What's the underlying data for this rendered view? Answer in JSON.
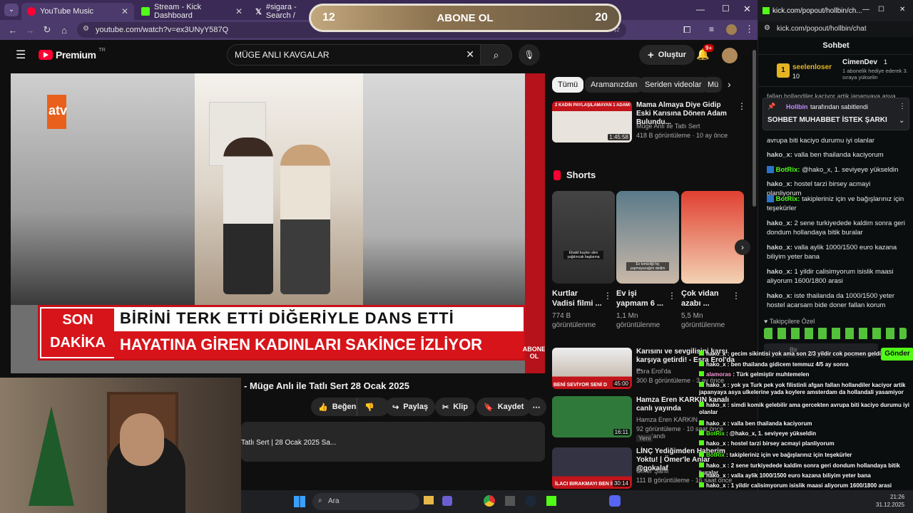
{
  "tabs": [
    {
      "label": "YouTube Music",
      "color": "#ff0033"
    },
    {
      "label": "Stream - Kick Dashboard",
      "color": "#53fc18"
    },
    {
      "label": "#sigara - Search /",
      "color": "#000000"
    }
  ],
  "browser": {
    "url": "youtube.com/watch?v=ex3UNyY587Q"
  },
  "youtube": {
    "logo": "Premium",
    "logo_region": "TR",
    "search_value": "MÜGE ANLI KAVGALAR",
    "create_label": "Oluştur",
    "notif_count": "9+",
    "video_title": "- Müge Anlı ile Tatlı Sert 28 Ocak 2025",
    "channel_logo": "atv",
    "description_snippet": "Tatlı Sert | 28 Ocak 2025 Sa...",
    "chyron_badge_top": "SON",
    "chyron_badge_bottom": "DAKİKA",
    "chyron_line1": "BİRİNİ TERK ETTİ DİĞERİYLE DANS ETTİ",
    "chyron_line2": "HAYATINA GİREN KADINLARI SAKİNCE İZLİYOR",
    "corner_watermark": "ABONE OL",
    "actions": {
      "like": "Beğen",
      "share": "Paylaş",
      "clip": "Klip",
      "save": "Kaydet"
    },
    "chips": [
      "Tümü",
      "Aramanızdan",
      "Seriden videolar",
      "Mü"
    ],
    "recs": [
      {
        "title": "Mama Almaya Diye Gidip Eski Karısına Dönen Adam Bulundu...",
        "channel": "Müge Anlı ile Tatlı Sert",
        "meta": "418 B görüntüleme · 10 ay önce",
        "duration": "1:45:58",
        "thumb_caption": "2 KADIN PAYLAŞILAMAYAN 1 ADAM!"
      },
      {
        "title": "Karısını ve sevgilisini karşı karşıya getirdi! - Esra Erol'da ...",
        "channel": "Esra Erol'da",
        "meta": "300 B görüntüleme · 3 ay önce",
        "duration": "45:00",
        "thumb_caption": "BENİ SEVİYOR SENİ D"
      },
      {
        "title": "Hamza Eren KARKIN kanalı canlı yayında",
        "channel": "Hamza Eren KARKIN",
        "meta": "92 görüntüleme · 10 saat önce yayınlandı",
        "duration": "16:11",
        "badge": "Yeni"
      },
      {
        "title": "LİNÇ Yediğimden Haberim Yoktu! | Ömer'le Anlar @gokalaf",
        "channel": "Ömer Şanlı",
        "meta": "111 B görüntüleme · 16 saat önce",
        "duration": "30:14",
        "badge": "Yeni",
        "thumb_caption": "İLACI BIRAKMAYI BEN İS"
      }
    ],
    "shorts_heading": "Shorts",
    "shorts": [
      {
        "title": "Kurtlar Vadisi filmi ...",
        "views": "774 B görüntülenme",
        "caption": "Ebabil kuşları alev yağdırıcak başlarına"
      },
      {
        "title": "Ev işi yapmam 6 ...",
        "views": "1,1 Mn görüntülenme",
        "caption": "Ev temizliği hiç yapmayacağım dedim"
      },
      {
        "title": "Çok vidan azabı ...",
        "views": "5,5 Mn görüntülenme",
        "caption": ""
      }
    ]
  },
  "abone": {
    "left": "12",
    "label": "ABONE OL",
    "right": "20"
  },
  "kick": {
    "url": "kick.com/popout/hollbin/chat",
    "tab_url": "kick.com/popout/hollbin/ch...",
    "heading": "Sohbet",
    "leader": {
      "name": "seelenloser",
      "count": "10"
    },
    "gifter": {
      "name": "CimenDev",
      "count": "1",
      "note": "1 abonelik hediye ederek 3. sıraya yükselin"
    },
    "pinned_by": "Hollbin",
    "pinned_suffix": "tarafından sabitlendi",
    "pinned_text": "SOHBET MUHABBET İSTEK ŞARKI",
    "top_cut": "fallan hollandiler kaciyor artik japanyaya asya",
    "messages": [
      {
        "text": "avrupa biti kaciyo durumu iyi olanlar"
      },
      {
        "user": "hako_x:",
        "text": "valla ben thailanda kaciyorum"
      },
      {
        "user": "BotRix:",
        "text": "@hako_x, 1. seviyeye yükseldin",
        "bot": true
      },
      {
        "user": "hako_x:",
        "text": "hostel tarzi birsey acmayi planliyorum"
      },
      {
        "user": "BotRix:",
        "text": "takipleriniz için ve bağışlarınız için teşekürler",
        "bot": true
      },
      {
        "user": "hako_x:",
        "text": "2 sene turkiyedede kaldim sonra geri dondum hollandaya bitik buralar"
      },
      {
        "user": "hako_x:",
        "text": "valla aylik 1000/1500 euro kazana biliyim yeter bana"
      },
      {
        "user": "hako_x:",
        "text": "1 yildir calisimyorum isislik maasi aliyorum 1600/1800 arasi"
      },
      {
        "user": "hako_x:",
        "text": "iste thailanda da 1000/1500 yeter hostel acarsam bide doner fallan korum"
      }
    ],
    "follower_label": "Takipçilere Özel",
    "send_label": "Gönder",
    "input_placeholder": "Bir"
  },
  "overlay_chat": [
    {
      "user": "hako_x",
      "text": "gecim sikintisi yok ama son 2/3 yildir cok pocmen geldi"
    },
    {
      "user": "hako_x",
      "text": "ben thailanda gidicem temmuz 4/5 ay sonra"
    },
    {
      "user": "alamoras",
      "text": "Türk gelmiştir muhtemelen"
    },
    {
      "user": "hako_x",
      "text": "yok ya Turk pek yok filistinli afgan fallan hollandiler kaciyor artik japanyaya asya ulkelerine yada koylere amsterdam da hollandali yasamiyor"
    },
    {
      "user": "hako_x",
      "text": "simdi komik gelebilir ama gercekten avrupa biti kaciyo durumu iyi olanlar"
    },
    {
      "user": "hako_x",
      "text": "valla ben thailanda kaciyorum"
    },
    {
      "user": "BotRix",
      "text": "@hako_x, 1. seviyeye yükseldin"
    },
    {
      "user": "hako_x",
      "text": "hostel tarzi birsey acmayi planliyorum"
    },
    {
      "user": "BotRix",
      "text": "takipleriniz için ve bağışlarınız için teşekürler"
    },
    {
      "user": "hako_x",
      "text": "2 sene turkiyedede kaldim sonra geri dondum hollandaya bitik buralar"
    },
    {
      "user": "hako_x",
      "text": "valla aylik 1000/1500 euro kazana biliyim yeter bana"
    },
    {
      "user": "hako_x",
      "text": "1 yildir calisimyorum isislik maasi aliyorum 1600/1800 arasi"
    },
    {
      "user": "hako_x",
      "text": "iste thailanda da 1000/1500 yeter hostel acarsam bide doner fallan korum"
    }
  ],
  "taskbar": {
    "search_placeholder": "Ara",
    "time": "21:26",
    "date": "31.12.2025"
  },
  "colors": {
    "kick_green": "#53fc18",
    "yt_red": "#ff0033",
    "chyron_red": "#d7141a"
  }
}
